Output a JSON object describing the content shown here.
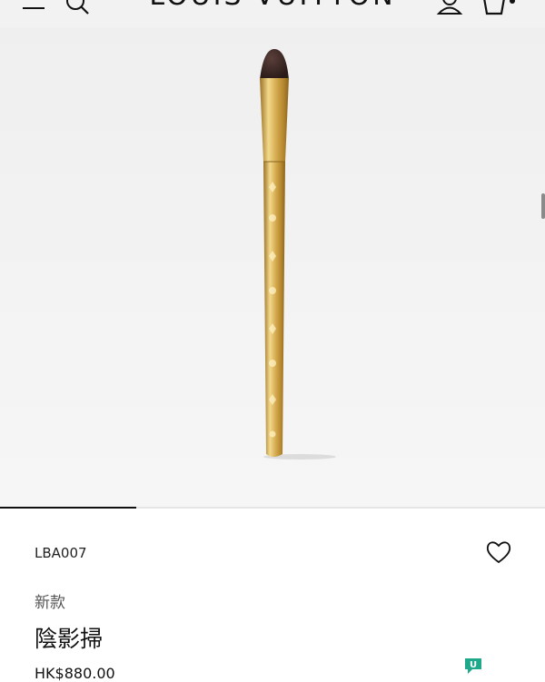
{
  "header": {
    "logo_text": "LOUIS VUITTON",
    "menu_icon": "hamburger-menu-icon",
    "search_icon": "search-icon",
    "account_icon": "user-icon",
    "cart_icon": "shopping-bag-icon",
    "cart_count": ""
  },
  "gallery": {
    "image": "eyeshadow-brush-gold-monogram",
    "progress_fraction": 0.25,
    "brush_colors": {
      "bristle": "#3a2623",
      "gold": "#d6ad52",
      "gold_light": "#f3d98c",
      "gold_dark": "#9a7326"
    }
  },
  "product": {
    "sku": "LBA007",
    "badge": "新款",
    "name": "陰影掃",
    "price": "HK$880.00",
    "wishlist_icon": "heart-icon"
  },
  "chat": {
    "icon": "chat-assistant-icon",
    "label": "U",
    "color": "#1fa88a"
  }
}
